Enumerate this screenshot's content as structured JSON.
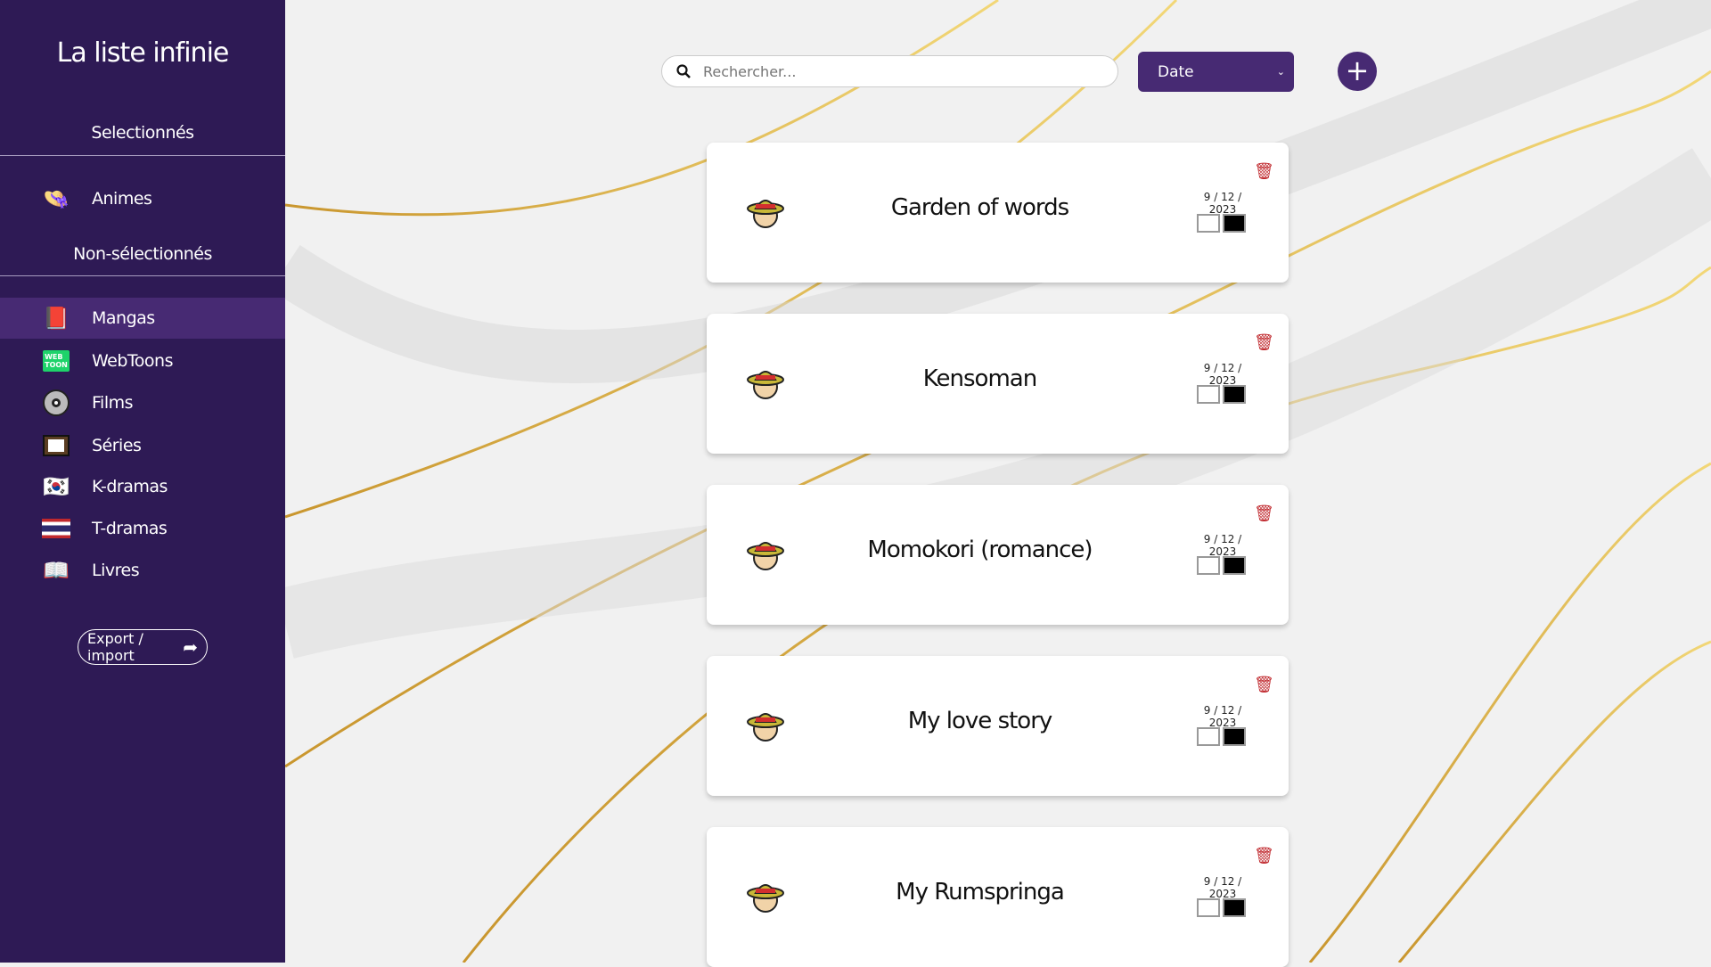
{
  "sidebar": {
    "title": "La liste infinie",
    "selected_heading": "Selectionnés",
    "unselected_heading": "Non-sélectionnés",
    "selected_items": [
      {
        "label": "Animes",
        "icon": "straw-hat-face-icon"
      }
    ],
    "items": [
      {
        "label": "Mangas",
        "icon": "manga-book-icon",
        "active": true
      },
      {
        "label": "WebToons",
        "icon": "webtoon-icon"
      },
      {
        "label": "Films",
        "icon": "disc-icon"
      },
      {
        "label": "Séries",
        "icon": "tv-icon"
      },
      {
        "label": "K-dramas",
        "icon": "korea-flag-icon"
      },
      {
        "label": "T-dramas",
        "icon": "thailand-flag-icon"
      },
      {
        "label": "Livres",
        "icon": "book-icon"
      }
    ],
    "export_label": "Export / import"
  },
  "toolbar": {
    "search_placeholder": "Rechercher...",
    "sort_value": "Date",
    "add_label": "+"
  },
  "colors": {
    "sidebar": "#2e1a55",
    "accent": "#472a73",
    "delete": "#c0282d"
  },
  "cards": [
    {
      "title": "Garden of words",
      "date": "9 / 12 / 2023"
    },
    {
      "title": "Kensoman",
      "date": "9 / 12 / 2023"
    },
    {
      "title": "Momokori (romance)",
      "date": "9 / 12 / 2023"
    },
    {
      "title": "My love story",
      "date": "9 / 12 / 2023"
    },
    {
      "title": "My Rumspringa",
      "date": "9 / 12 / 2023"
    }
  ]
}
